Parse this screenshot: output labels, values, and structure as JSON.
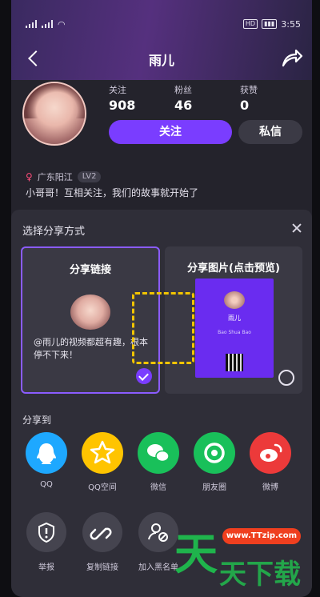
{
  "status": {
    "time": "3:55",
    "left_icons": [
      "signal-icon",
      "wifi-icon"
    ],
    "right_icons": [
      "hd-icon",
      "battery-icon"
    ]
  },
  "header": {
    "title": "雨儿"
  },
  "profile": {
    "stats": [
      {
        "label": "关注",
        "value": "908"
      },
      {
        "label": "粉丝",
        "value": "46"
      },
      {
        "label": "获赞",
        "value": "0"
      }
    ],
    "follow_label": "关注",
    "message_label": "私信",
    "location": "广东阳江",
    "level": "LV2",
    "bio": "小哥哥！互相关注，我们的故事就开始了"
  },
  "sheet": {
    "title": "选择分享方式",
    "link_option": {
      "title": "分享链接",
      "text": "@雨儿的视频都超有趣，根本停不下来！"
    },
    "image_option": {
      "title": "分享图片(点击预览)",
      "poster_name": "雨儿",
      "poster_id": "Bao Shua Bao"
    },
    "share_to_label": "分享到",
    "share_targets": [
      {
        "label": "QQ",
        "icon": "qq-icon",
        "color": "#1ea8ff"
      },
      {
        "label": "QQ空间",
        "icon": "qzone-icon",
        "color": "#ffc400"
      },
      {
        "label": "微信",
        "icon": "wechat-icon",
        "color": "#19c05a"
      },
      {
        "label": "朋友圈",
        "icon": "moments-icon",
        "color": "#19c05a"
      },
      {
        "label": "微博",
        "icon": "weibo-icon",
        "color": "#ec3a3a"
      }
    ],
    "actions": [
      {
        "label": "举报",
        "icon": "report-icon"
      },
      {
        "label": "复制链接",
        "icon": "link-icon"
      },
      {
        "label": "加入黑名单",
        "icon": "block-user-icon"
      }
    ]
  },
  "watermark": {
    "url": "www.TTzip.com",
    "big_char": "天",
    "text": "天下载"
  }
}
